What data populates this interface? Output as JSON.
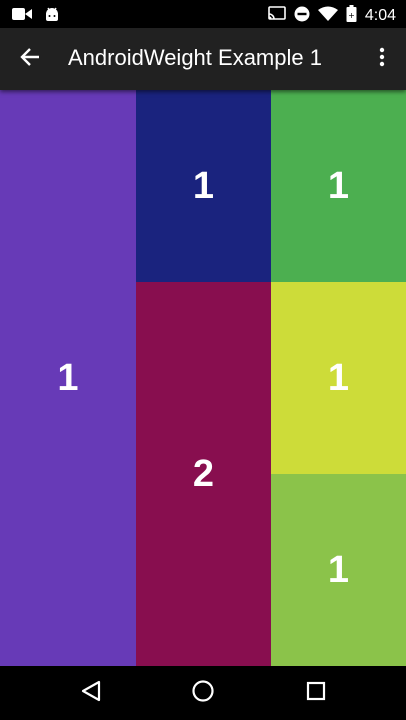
{
  "status_bar": {
    "time": "4:04",
    "icons": [
      "video-camera-icon",
      "android-icon",
      "cast-icon",
      "do-not-disturb-icon",
      "wifi-icon",
      "battery-icon"
    ]
  },
  "app_bar": {
    "title": "AndroidWeight Example 1",
    "back_icon": "arrow-back-icon",
    "overflow_icon": "more-vert-icon",
    "background": "#212121"
  },
  "layout": {
    "columns": [
      {
        "name": "left",
        "cells": [
          {
            "label": "1",
            "weight": 1,
            "color": "#673AB7"
          }
        ]
      },
      {
        "name": "middle",
        "cells": [
          {
            "label": "1",
            "weight": 1,
            "color": "#1A237E"
          },
          {
            "label": "2",
            "weight": 2,
            "color": "#880E4F"
          }
        ]
      },
      {
        "name": "right",
        "cells": [
          {
            "label": "1",
            "weight": 1,
            "color": "#4CAF50"
          },
          {
            "label": "1",
            "weight": 1,
            "color": "#CDDC39"
          },
          {
            "label": "1",
            "weight": 1,
            "color": "#8BC34A"
          }
        ]
      }
    ]
  },
  "nav_bar": {
    "icons": [
      "back-triangle-icon",
      "home-circle-icon",
      "recents-square-icon"
    ]
  }
}
